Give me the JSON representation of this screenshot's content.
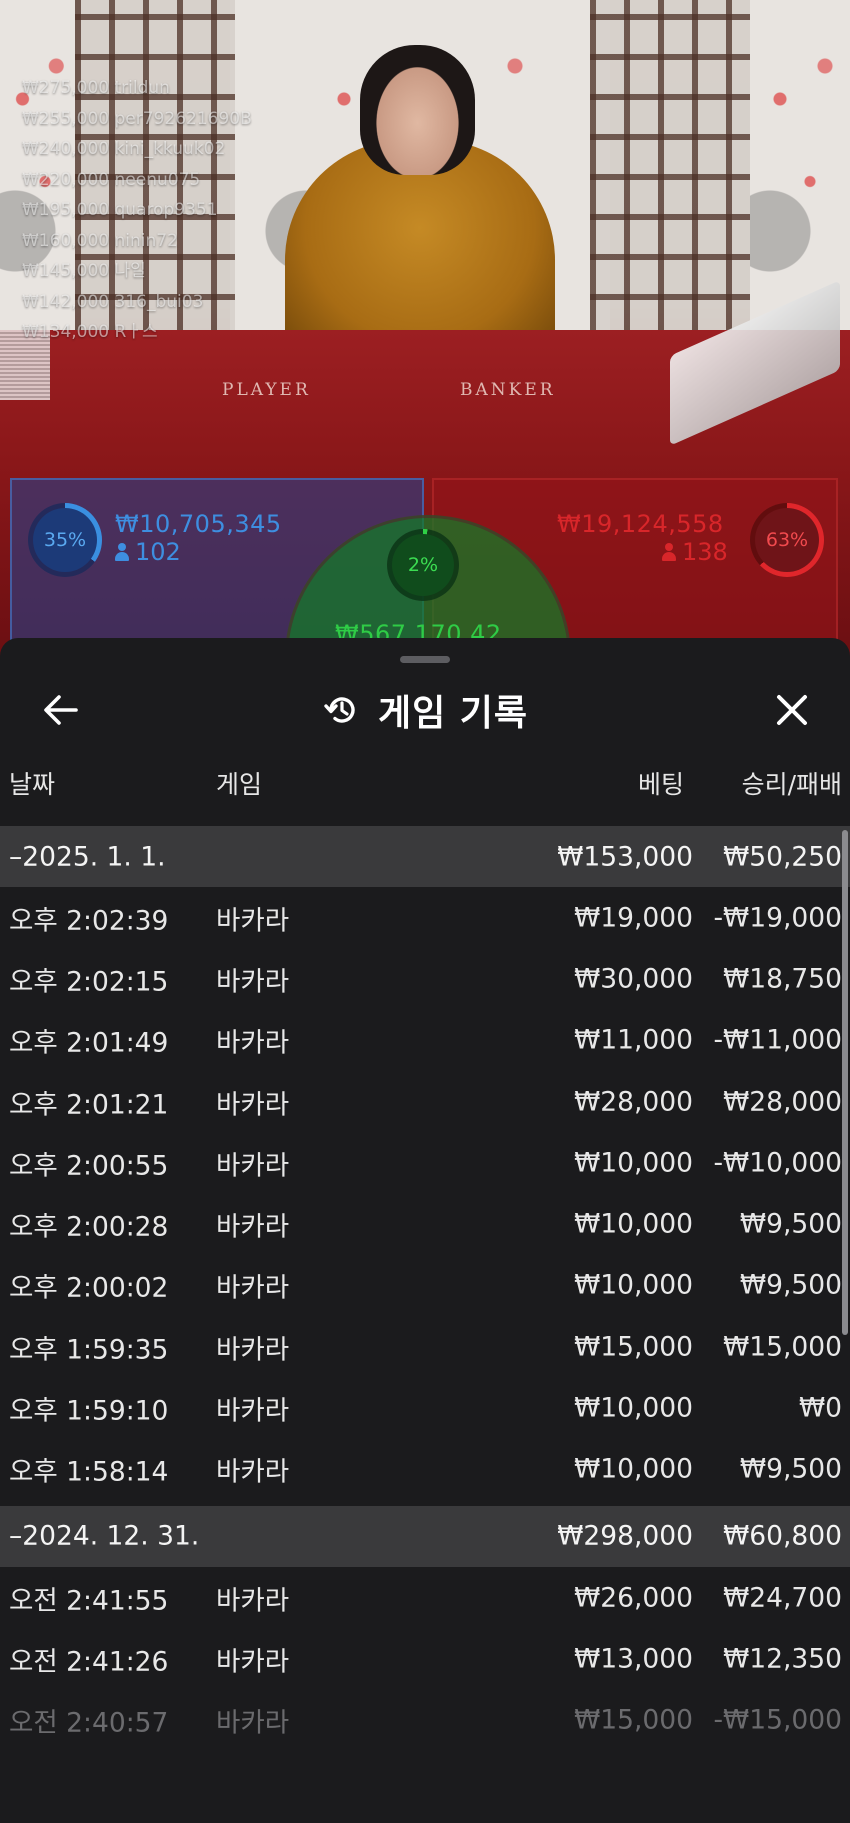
{
  "leaderboard": [
    {
      "text": "₩275,000 trildun"
    },
    {
      "text": "₩255,000 per792621690B"
    },
    {
      "text": "₩240,000 kini_kkuuk02"
    },
    {
      "text": "₩220,000 neenu075"
    },
    {
      "text": "₩195,000 quarop9351"
    },
    {
      "text": "₩160,000 ninin72"
    },
    {
      "text": "₩145,000 나일"
    },
    {
      "text": "₩142,000 316_bui03"
    },
    {
      "text": "₩134,000 Rㅏ스"
    }
  ],
  "table": {
    "player_word": "PLAYER",
    "banker_word": "BANKER"
  },
  "stats": {
    "player": {
      "percent_label": "35%",
      "amount": "₩10,705,345",
      "count": "102",
      "color": "#3a8fe0",
      "percent": 35
    },
    "banker": {
      "percent_label": "63%",
      "amount": "₩19,124,558",
      "count": "138",
      "color": "#e0262b",
      "percent": 63
    },
    "tie": {
      "percent_label": "2%",
      "amount": "₩567,170.42",
      "color": "#2fd046",
      "percent": 2
    }
  },
  "sheet": {
    "title": "게임 기록",
    "title_icon": "history-icon",
    "back_icon": "arrow-left-icon",
    "close_icon": "close-icon"
  },
  "columns": {
    "date": "날짜",
    "game": "게임",
    "bet": "베팅",
    "result": "승리/패배"
  },
  "groups": [
    {
      "date": "–2025. 1. 1.",
      "total_bet": "₩153,000",
      "total_result": "₩50,250",
      "rows": [
        {
          "time": "오후 2:02:39",
          "game": "바카라",
          "bet": "₩19,000",
          "result": "-₩19,000"
        },
        {
          "time": "오후 2:02:15",
          "game": "바카라",
          "bet": "₩30,000",
          "result": "₩18,750"
        },
        {
          "time": "오후 2:01:49",
          "game": "바카라",
          "bet": "₩11,000",
          "result": "-₩11,000"
        },
        {
          "time": "오후 2:01:21",
          "game": "바카라",
          "bet": "₩28,000",
          "result": "₩28,000"
        },
        {
          "time": "오후 2:00:55",
          "game": "바카라",
          "bet": "₩10,000",
          "result": "-₩10,000"
        },
        {
          "time": "오후 2:00:28",
          "game": "바카라",
          "bet": "₩10,000",
          "result": "₩9,500"
        },
        {
          "time": "오후 2:00:02",
          "game": "바카라",
          "bet": "₩10,000",
          "result": "₩9,500"
        },
        {
          "time": "오후 1:59:35",
          "game": "바카라",
          "bet": "₩15,000",
          "result": "₩15,000"
        },
        {
          "time": "오후 1:59:10",
          "game": "바카라",
          "bet": "₩10,000",
          "result": "₩0"
        },
        {
          "time": "오후 1:58:14",
          "game": "바카라",
          "bet": "₩10,000",
          "result": "₩9,500"
        }
      ]
    },
    {
      "date": "–2024. 12. 31.",
      "total_bet": "₩298,000",
      "total_result": "₩60,800",
      "rows": [
        {
          "time": "오전 2:41:55",
          "game": "바카라",
          "bet": "₩26,000",
          "result": "₩24,700"
        },
        {
          "time": "오전 2:41:26",
          "game": "바카라",
          "bet": "₩13,000",
          "result": "₩12,350"
        },
        {
          "time": "오전 2:40:57",
          "game": "바카라",
          "bet": "₩15,000",
          "result": "-₩15,000"
        }
      ]
    }
  ]
}
